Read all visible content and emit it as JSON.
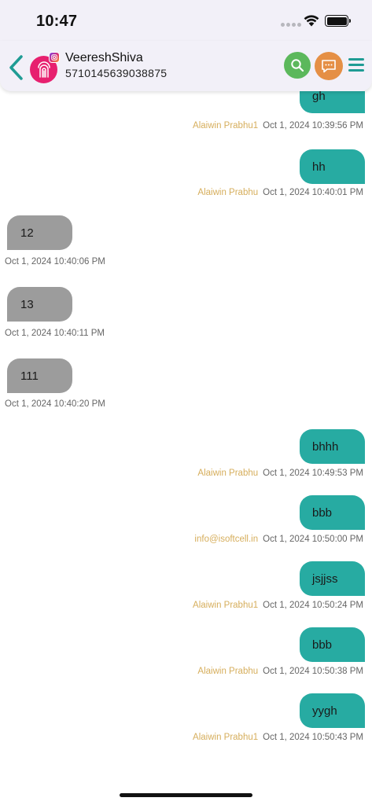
{
  "status_bar": {
    "time": "10:47"
  },
  "header": {
    "contact_name": "VeereshShiva",
    "contact_number": "5710145639038875",
    "colors": {
      "accent": "#1f9c94",
      "search": "#5cb85c",
      "chat": "#e58f45",
      "avatar": "#e7206f"
    },
    "icons": [
      "chevron-left-icon",
      "fingerprint-icon",
      "instagram-icon",
      "search-icon",
      "chat-bubble-icon",
      "hamburger-menu-icon"
    ]
  },
  "messages": [
    {
      "direction": "out",
      "text": "gh",
      "sender": "Alaiwin Prabhu1",
      "timestamp": "Oct 1, 2024 10:39:56 PM"
    },
    {
      "direction": "out",
      "text": "hh",
      "sender": "Alaiwin Prabhu",
      "timestamp": "Oct 1, 2024 10:40:01 PM"
    },
    {
      "direction": "in",
      "text": "12",
      "timestamp": "Oct 1, 2024 10:40:06 PM"
    },
    {
      "direction": "in",
      "text": "13",
      "timestamp": "Oct 1, 2024 10:40:11 PM"
    },
    {
      "direction": "in",
      "text": "111",
      "timestamp": "Oct 1, 2024 10:40:20 PM"
    },
    {
      "direction": "out",
      "text": "bhhh",
      "sender": "Alaiwin Prabhu",
      "timestamp": "Oct 1, 2024 10:49:53 PM"
    },
    {
      "direction": "out",
      "text": "bbb",
      "sender": "info@isoftcell.in",
      "timestamp": "Oct 1, 2024 10:50:00 PM"
    },
    {
      "direction": "out",
      "text": "jsjjss",
      "sender": "Alaiwin Prabhu1",
      "timestamp": "Oct 1, 2024 10:50:24 PM"
    },
    {
      "direction": "out",
      "text": "bbb",
      "sender": "Alaiwin Prabhu",
      "timestamp": "Oct 1, 2024 10:50:38 PM"
    },
    {
      "direction": "out",
      "text": "yygh",
      "sender": "Alaiwin Prabhu1",
      "timestamp": "Oct 1, 2024 10:50:43 PM"
    }
  ]
}
